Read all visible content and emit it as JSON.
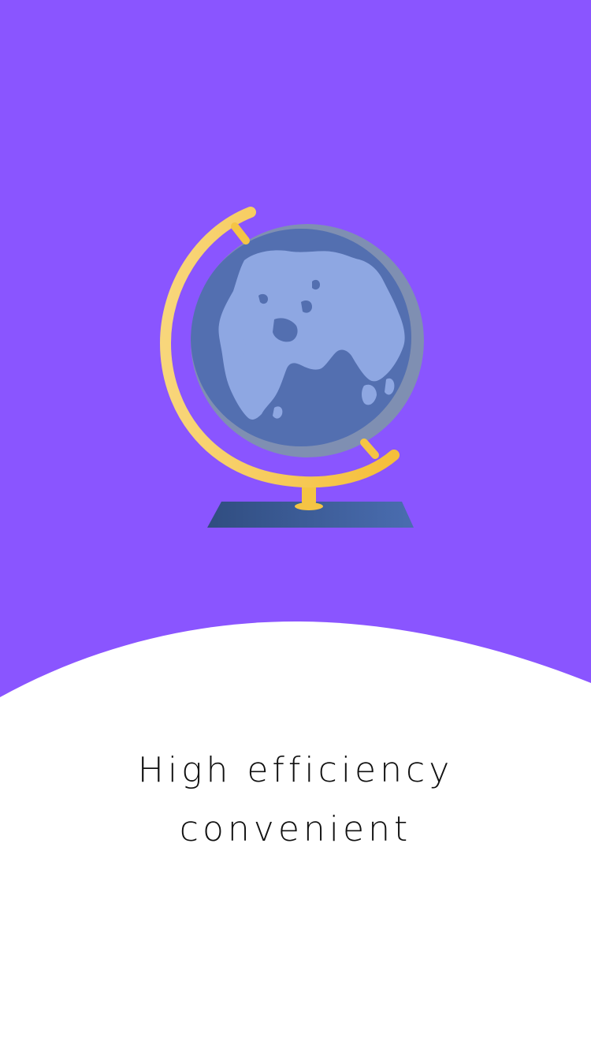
{
  "colors": {
    "background": "#8A55FF",
    "surface": "#FFFFFF",
    "text": "#111111",
    "globe_ocean": "#536FB0",
    "globe_land": "#8EA7E2",
    "globe_stand": "#F7C64B",
    "globe_base": "#35558C"
  },
  "illustration": {
    "icon": "globe-icon"
  },
  "tagline": {
    "line1": "High efficiency",
    "line2": "convenient"
  }
}
